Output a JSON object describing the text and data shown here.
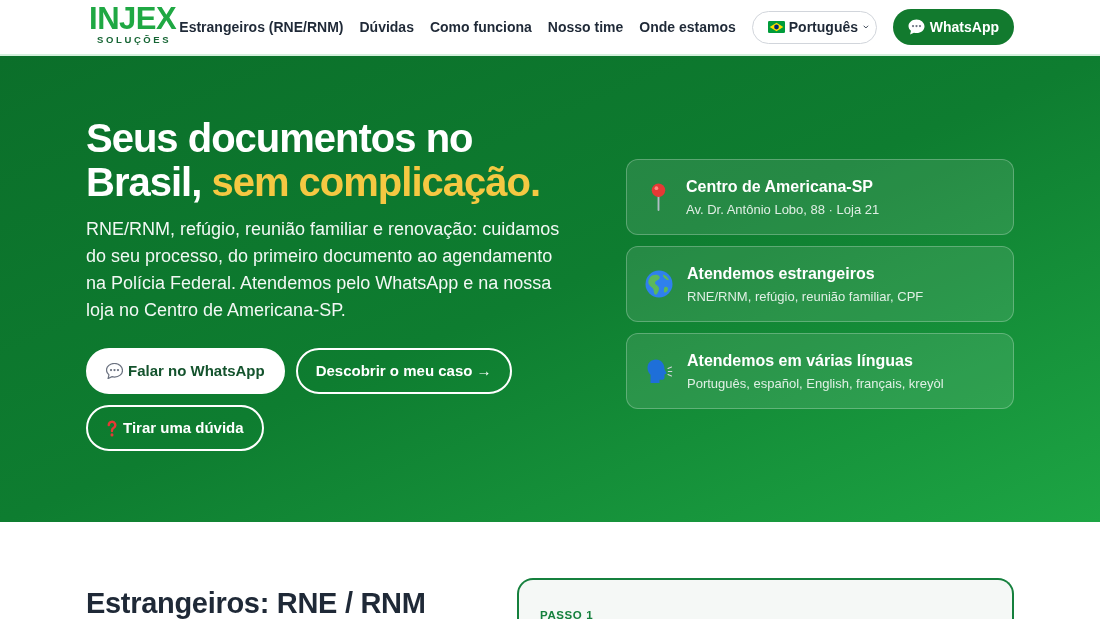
{
  "header": {
    "logo": {
      "wordmark": "INJEX",
      "tagline": "SOLUÇÕES"
    },
    "nav": [
      "Estrangeiros (RNE/RNM)",
      "Dúvidas",
      "Como funciona",
      "Nosso time",
      "Onde estamos"
    ],
    "language_select": {
      "value": "Português"
    },
    "whatsapp_button": {
      "label": "WhatsApp"
    }
  },
  "hero": {
    "title": "Seus documentos no Brasil,",
    "title_highlight": "sem complicação.",
    "description": "RNE/RNM, refúgio, reunião familiar e renovação: cuidamos do seu processo, do primeiro documento ao agendamento na Polícia Federal. Atendemos pelo WhatsApp e na nossa loja no Centro de Americana-SP.",
    "buttons": [
      {
        "label": "Falar no WhatsApp",
        "kind": "solid"
      },
      {
        "label": "Descobrir o meu caso →",
        "kind": "outline"
      },
      {
        "label": "Tirar uma dúvida",
        "kind": "outline"
      }
    ],
    "info_cards": [
      {
        "title": "Centro de Americana-SP",
        "subtitle": "Av. Dr. Antônio Lobo, 88 · Loja 21"
      },
      {
        "title": "Atendemos estrangeiros",
        "subtitle": "RNE/RNM, refúgio, reunião familiar, CPF"
      },
      {
        "title": "Atendemos em várias línguas",
        "subtitle": "Português, español, English, français, kreyòl"
      }
    ]
  },
  "section": {
    "title": "Estrangeiros: RNE / RNM",
    "step_card": {
      "label": "PASSO 1"
    }
  }
}
